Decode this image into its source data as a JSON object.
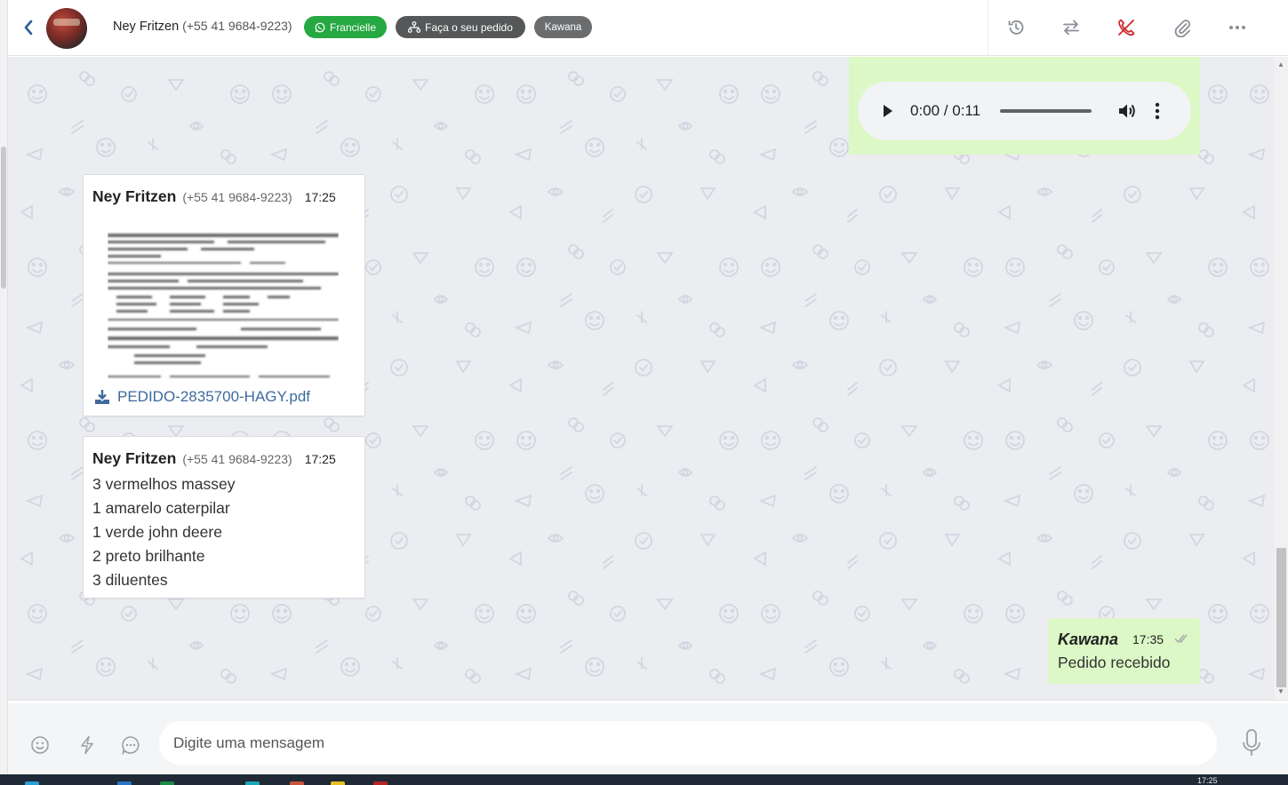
{
  "header": {
    "contact_name": "Ney Fritzen",
    "contact_phone": "(+55 41 9684-9223)",
    "tags": {
      "agent": "Francielle",
      "flow": "Faça o seu pedido",
      "user": "Kawana"
    },
    "icons": [
      "history-icon",
      "transfer-icon",
      "end-call-icon",
      "attach-icon",
      "more-icon"
    ]
  },
  "messages": {
    "audio": {
      "time_display": "0:00 / 0:11"
    },
    "pdf": {
      "sender": "Ney Fritzen",
      "phone": "(+55 41 9684-9223)",
      "time": "17:25",
      "filename": "PEDIDO-2835700-HAGY.pdf"
    },
    "text": {
      "sender": "Ney Fritzen",
      "phone": "(+55 41 9684-9223)",
      "time": "17:25",
      "lines": [
        "3 vermelhos massey",
        "1 amarelo caterpilar",
        "1 verde john deere",
        "2 preto brilhante",
        "3 diluentes"
      ]
    },
    "reply": {
      "sender": "Kawana",
      "time": "17:35",
      "text": "Pedido recebido"
    }
  },
  "composer": {
    "placeholder": "Digite uma mensagem"
  },
  "taskbar": {
    "clock": "17:25"
  },
  "colors": {
    "accent_green": "#26a842",
    "outgoing_bubble": "#dcf8c6",
    "chat_bg": "#ebedf1",
    "link_blue": "#3e6a9e",
    "end_call_red": "#d0282e"
  }
}
